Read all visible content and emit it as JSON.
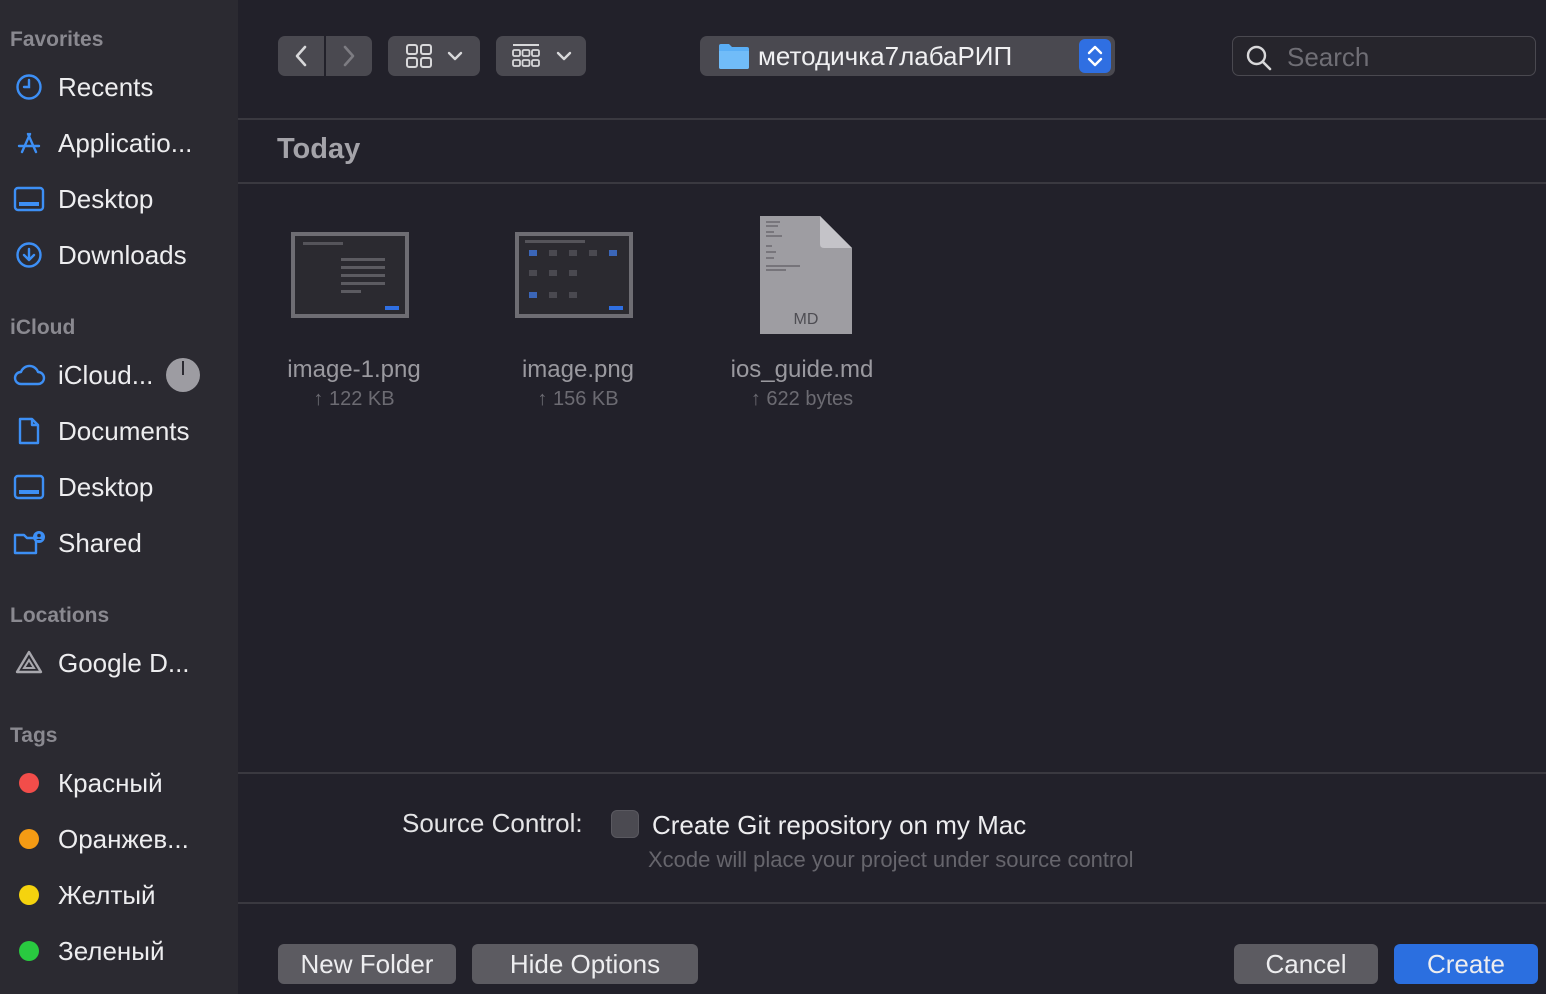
{
  "sidebar": {
    "favorites_title": "Favorites",
    "favorites": [
      {
        "label": "Recents",
        "icon": "clock-icon"
      },
      {
        "label": "Applicatio...",
        "icon": "applications-icon"
      },
      {
        "label": "Desktop",
        "icon": "desktop-icon"
      },
      {
        "label": "Downloads",
        "icon": "downloads-icon"
      }
    ],
    "icloud_title": "iCloud",
    "icloud": [
      {
        "label": "iCloud...",
        "icon": "cloud-icon"
      },
      {
        "label": "Documents",
        "icon": "document-icon"
      },
      {
        "label": "Desktop",
        "icon": "desktop-icon"
      },
      {
        "label": "Shared",
        "icon": "shared-folder-icon"
      }
    ],
    "locations_title": "Locations",
    "locations": [
      {
        "label": "Google D...",
        "icon": "google-drive-icon"
      }
    ],
    "tags_title": "Tags",
    "tags": [
      {
        "label": "Красный",
        "color": "#f24d4a"
      },
      {
        "label": "Оранжев...",
        "color": "#f59b14"
      },
      {
        "label": "Желтый",
        "color": "#f5d30e"
      },
      {
        "label": "Зеленый",
        "color": "#29c940"
      }
    ]
  },
  "toolbar": {
    "path": "методичка7лабаРИП",
    "search_placeholder": "Search"
  },
  "content": {
    "group_title": "Today",
    "files": [
      {
        "name": "image-1.png",
        "size": "↑ 122 KB",
        "kind": "image"
      },
      {
        "name": "image.png",
        "size": "↑ 156 KB",
        "kind": "image"
      },
      {
        "name": "ios_guide.md",
        "size": "↑ 622 bytes",
        "kind": "md",
        "badge": "MD"
      }
    ]
  },
  "options": {
    "source_control_label": "Source Control:",
    "git_checkbox_label": "Create Git repository on my Mac",
    "git_hint": "Xcode will place your project under source control",
    "git_checked": false
  },
  "buttons": {
    "new_folder": "New Folder",
    "hide_options": "Hide Options",
    "cancel": "Cancel",
    "create": "Create"
  },
  "colors": {
    "accent": "#2b6fe0",
    "sidebar_icon": "#3d8ff5"
  }
}
